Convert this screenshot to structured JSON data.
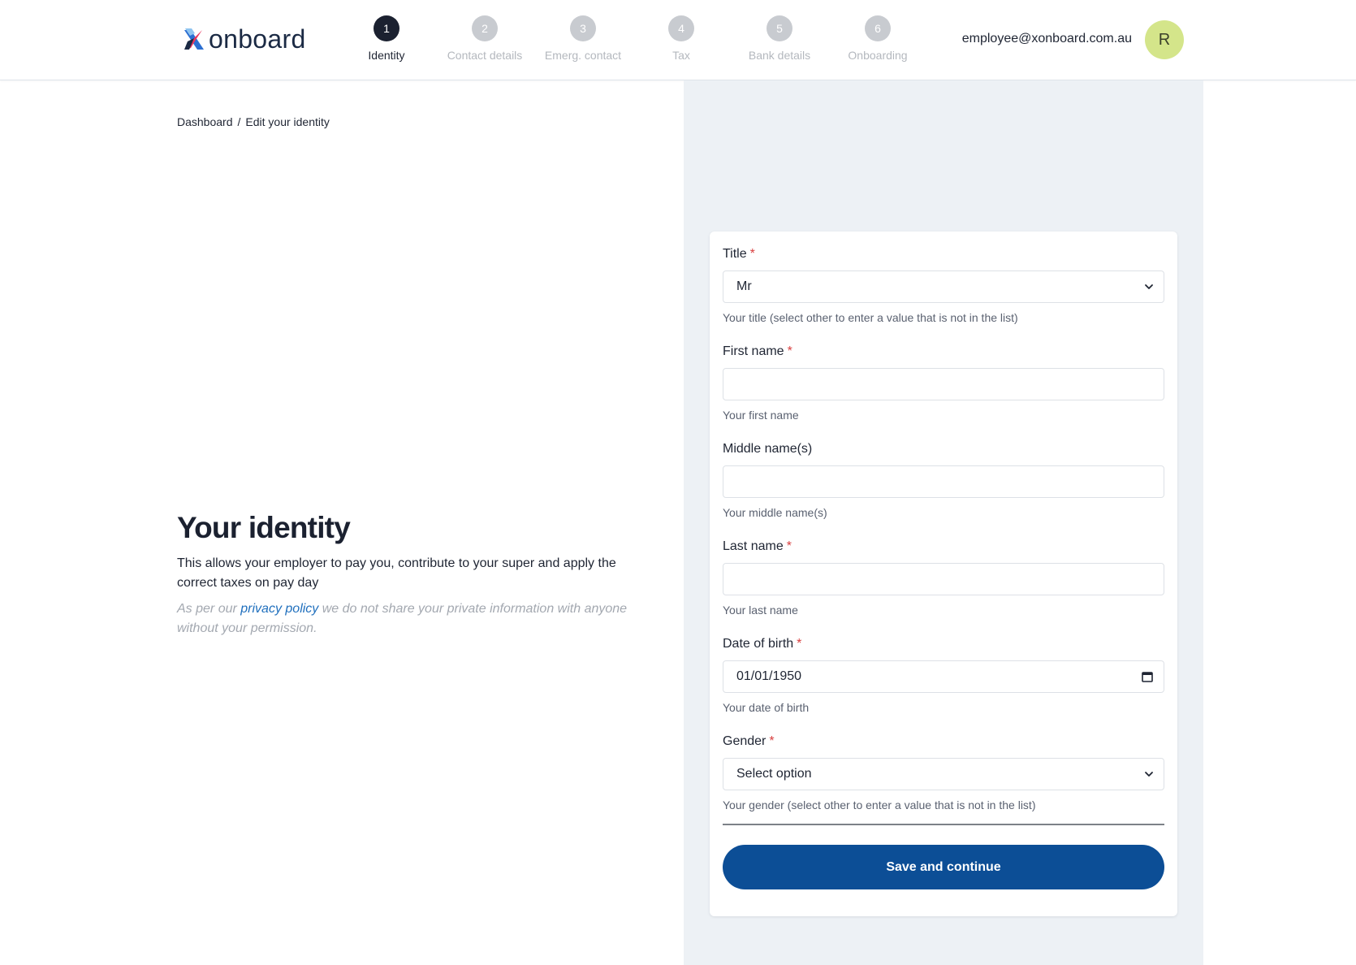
{
  "header": {
    "logo_text": "onboard",
    "logo_brand_letter": "x",
    "user_email": "employee@xonboard.com.au",
    "avatar_initial": "R",
    "steps": [
      {
        "number": "1",
        "label": "Identity",
        "active": true
      },
      {
        "number": "2",
        "label": "Contact details",
        "active": false
      },
      {
        "number": "3",
        "label": "Emerg. contact",
        "active": false
      },
      {
        "number": "4",
        "label": "Tax",
        "active": false
      },
      {
        "number": "5",
        "label": "Bank details",
        "active": false
      },
      {
        "number": "6",
        "label": "Onboarding",
        "active": false
      }
    ]
  },
  "breadcrumb": {
    "home": "Dashboard",
    "separator": "/",
    "current": "Edit your identity"
  },
  "intro": {
    "title": "Your identity",
    "lead": "This allows your employer to pay you, contribute to your super and apply the correct taxes on pay day",
    "privacy_prefix": "As per our ",
    "privacy_link": "privacy policy",
    "privacy_suffix": " we do not share your private information with anyone without your permission."
  },
  "form": {
    "required_marker": "*",
    "title": {
      "label": "Title",
      "value": "Mr",
      "help": "Your title (select other to enter a value that is not in the list)"
    },
    "first_name": {
      "label": "First name",
      "value": "",
      "help": "Your first name"
    },
    "middle_name": {
      "label": "Middle name(s)",
      "value": "",
      "help": "Your middle name(s)"
    },
    "last_name": {
      "label": "Last name",
      "value": "",
      "help": "Your last name"
    },
    "dob": {
      "label": "Date of birth",
      "value": "01/01/1950",
      "help": "Your date of birth"
    },
    "gender": {
      "label": "Gender",
      "value": "Select option",
      "help": "Your gender (select other to enter a value that is not in the list)"
    },
    "submit_label": "Save and continue"
  },
  "colors": {
    "primary": "#0c4e96",
    "active_step": "#1b2130",
    "inactive_step": "#c8cbd0",
    "panel_bg": "#edf1f5",
    "avatar_bg": "#d4e58a",
    "required": "#d94040",
    "link": "#1f6fbd"
  },
  "icons": {
    "select": "chevron-down-icon",
    "date": "calendar-icon"
  }
}
